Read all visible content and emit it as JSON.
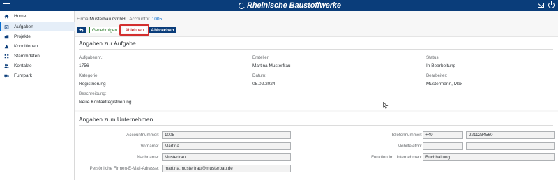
{
  "header": {
    "brand": "Rheinische Baustoffwerke"
  },
  "sidebar": {
    "items": [
      {
        "label": "Home",
        "icon": "home-icon"
      },
      {
        "label": "Aufgaben",
        "icon": "tasks-icon"
      },
      {
        "label": "Projekte",
        "icon": "projects-icon"
      },
      {
        "label": "Konditionen",
        "icon": "conditions-icon"
      },
      {
        "label": "Stammdaten",
        "icon": "masterdata-icon"
      },
      {
        "label": "Kontakte",
        "icon": "contacts-icon"
      },
      {
        "label": "Fuhrpark",
        "icon": "truck-icon"
      }
    ],
    "active": "Aufgaben"
  },
  "breadcrumb": {
    "firma_label": "Firma",
    "firma_value": "Musterbau GmbH",
    "account_label": "Accountnr.",
    "account_value": "1005"
  },
  "toolbar": {
    "accept_label": "Genehmigen",
    "reject_label": "Ablehnen",
    "cancel_label": "Abbrechen"
  },
  "task": {
    "title": "Angaben zur Aufgabe",
    "fields": {
      "aufgabennr": {
        "label": "Aufgabennr.:",
        "value": "1756"
      },
      "ersteller": {
        "label": "Ersteller:",
        "value": "Martina Musterfrau"
      },
      "status": {
        "label": "Status:",
        "value": "In Bearbeitung"
      },
      "kategorie": {
        "label": "Kategorie:",
        "value": "Registrierung"
      },
      "datum": {
        "label": "Datum:",
        "value": "05.02.2024"
      },
      "bearbeiter": {
        "label": "Bearbeiter:",
        "value": "Mustermann, Max"
      },
      "beschreibung": {
        "label": "Beschreibung:",
        "value": "Neue Kontaktregistrierung"
      }
    }
  },
  "company": {
    "title": "Angaben zum Unternehmen",
    "fields": {
      "accountnummer": {
        "label": "Accountnummer:",
        "value": "1005"
      },
      "vorname": {
        "label": "Vorname:",
        "value": "Martina"
      },
      "nachname": {
        "label": "Nachname:",
        "value": "Musterfrau"
      },
      "email": {
        "label": "Persönliche Firmen-E-Mail-Adresse:",
        "value": "martina.musterfrau@musterbau.de"
      },
      "telefon": {
        "label": "Telefonnummer:",
        "prefix": "+49",
        "value": "2211234560"
      },
      "mobil": {
        "label": "Mobiltelefon:",
        "prefix": "",
        "value": ""
      },
      "funktion": {
        "label": "Funktion im Unternehmen:",
        "value": "Buchhaltung"
      }
    }
  },
  "colors": {
    "header_bg": "#0a3d7a",
    "accept": "#2b7c2b",
    "reject": "#bb0000",
    "highlight": "#d32f2f",
    "link": "#0a6ed1"
  }
}
